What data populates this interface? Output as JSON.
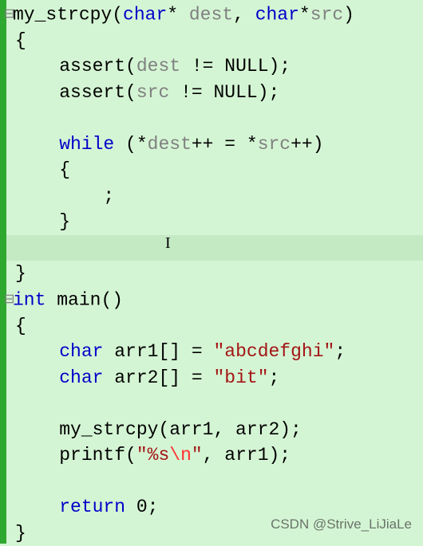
{
  "code": {
    "l1": {
      "fn": "my_strcpy",
      "lp": "(",
      "ty1": "char",
      "star1": "* ",
      "p1": "dest",
      "comma": ", ",
      "ty2": "char",
      "star2": "*",
      "p2": "src",
      "rp": ")"
    },
    "l2": "{",
    "l3": {
      "indent": "    ",
      "call": "assert(",
      "arg": "dest",
      "neq": " != ",
      "null": "NULL",
      "end": ");"
    },
    "l4": {
      "indent": "    ",
      "call": "assert(",
      "arg": "src",
      "neq": " != ",
      "null": "NULL",
      "end": ");"
    },
    "l5": "",
    "l6": {
      "indent": "    ",
      "kw": "while",
      "sp": " (*",
      "d": "dest",
      "inc1": "++ = *",
      "s": "src",
      "inc2": "++)"
    },
    "l7": "    {",
    "l8": "        ;",
    "l9": "    }",
    "l10": "",
    "l11": "}",
    "l12": {
      "ty": "int",
      "sp": " ",
      "fn": "main",
      "paren": "()"
    },
    "l13": "{",
    "l14": {
      "indent": "    ",
      "ty": "char",
      "sp": " ",
      "var": "arr1[] = ",
      "q1": "\"",
      "s": "abcdefghi",
      "q2": "\"",
      "end": ";"
    },
    "l15": {
      "indent": "    ",
      "ty": "char",
      "sp": " ",
      "var": "arr2[] = ",
      "q1": "\"",
      "s": "bit",
      "q2": "\"",
      "end": ";"
    },
    "l16": "",
    "l17": "    my_strcpy(arr1, arr2);",
    "l18": {
      "indent": "    ",
      "fn": "printf(",
      "q1": "\"",
      "fmt": "%s",
      "esc": "\\n",
      "q2": "\"",
      "rest": ", arr1);"
    },
    "l19": "",
    "l20": {
      "indent": "    ",
      "kw": "return",
      "sp": " ",
      "num": "0",
      "end": ";"
    },
    "l21": "}"
  },
  "cursor_glyph": "I",
  "fold_glyph": "⊟",
  "watermark": "CSDN @Strive_LiJiaLe"
}
